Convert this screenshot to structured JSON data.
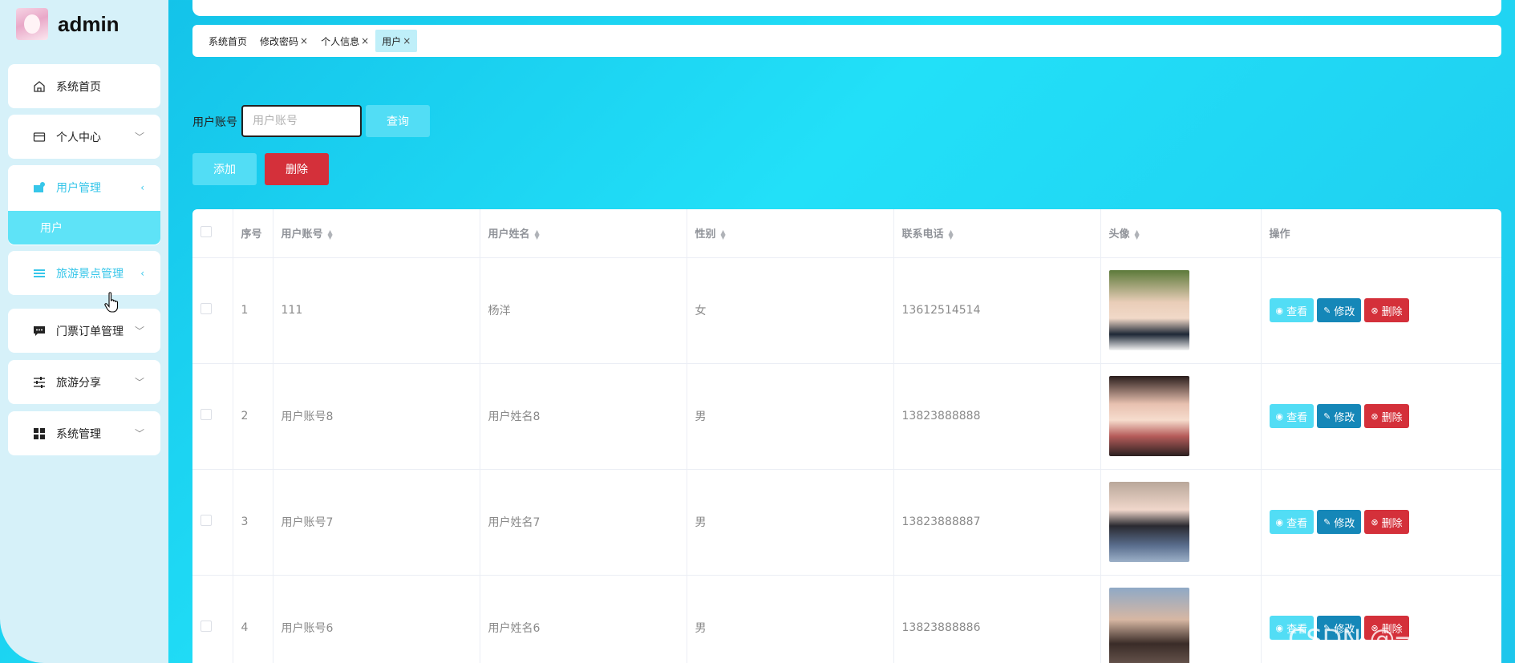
{
  "brand": {
    "title": "admin"
  },
  "sidebar": {
    "items": [
      {
        "label": "系统首页",
        "icon": "home-icon"
      },
      {
        "label": "个人中心",
        "icon": "card-icon"
      },
      {
        "label": "用户管理",
        "icon": "user-folder-icon",
        "sub": [
          {
            "label": "用户"
          }
        ]
      },
      {
        "label": "旅游景点管理",
        "icon": "list-icon"
      },
      {
        "label": "门票订单管理",
        "icon": "chat-icon"
      },
      {
        "label": "旅游分享",
        "icon": "sliders-icon"
      },
      {
        "label": "系统管理",
        "icon": "grid-icon"
      }
    ]
  },
  "tabs": [
    {
      "label": "系统首页",
      "closable": false
    },
    {
      "label": "修改密码",
      "closable": true
    },
    {
      "label": "个人信息",
      "closable": true
    },
    {
      "label": "用户",
      "closable": true,
      "active": true
    }
  ],
  "search": {
    "label": "用户账号",
    "placeholder": "用户账号",
    "query_label": "查询"
  },
  "actions": {
    "add_label": "添加",
    "delete_label": "删除"
  },
  "table": {
    "headers": [
      "序号",
      "用户账号",
      "用户姓名",
      "性别",
      "联系电话",
      "头像",
      "操作"
    ],
    "rows": [
      {
        "index": "1",
        "account": "111",
        "name": "杨洋",
        "gender": "女",
        "phone": "13612514514"
      },
      {
        "index": "2",
        "account": "用户账号8",
        "name": "用户姓名8",
        "gender": "男",
        "phone": "13823888888"
      },
      {
        "index": "3",
        "account": "用户账号7",
        "name": "用户姓名7",
        "gender": "男",
        "phone": "13823888887"
      },
      {
        "index": "4",
        "account": "用户账号6",
        "name": "用户姓名6",
        "gender": "男",
        "phone": "13823888886"
      }
    ],
    "row_actions": {
      "view": "查看",
      "edit": "修改",
      "delete": "删除"
    }
  },
  "watermark": "CSDN @一季春秋",
  "colors": {
    "accent": "#52ddf5",
    "danger": "#d4303a",
    "edit": "#1587b8"
  }
}
